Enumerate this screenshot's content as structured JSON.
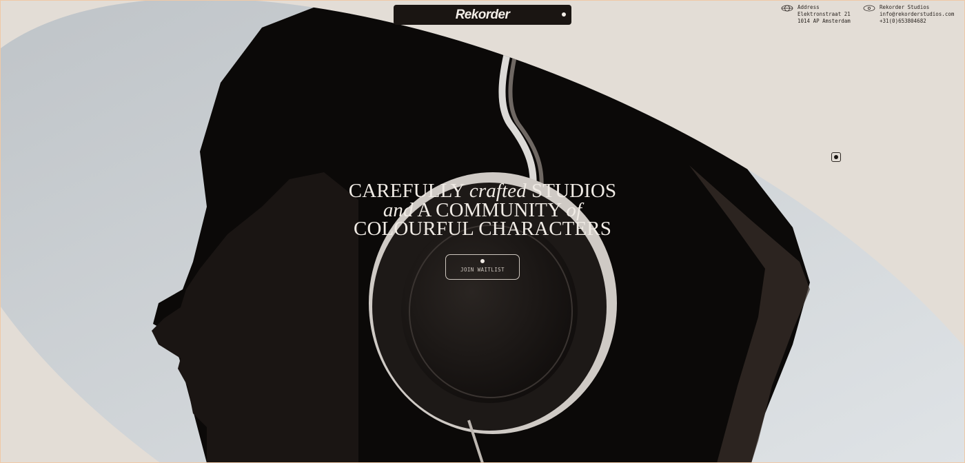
{
  "brand": {
    "name": "Rekorder"
  },
  "contact": {
    "address": {
      "title": "Address",
      "line1": "Elektronstraat 21",
      "line2": "1014 AP Amsterdam"
    },
    "studio": {
      "title": "Rekorder Studios",
      "email": "info@rekorderstudios.com",
      "phone": "+31(0)653804682"
    }
  },
  "hero": {
    "line1_a": "CAREFULLY",
    "line1_b": "crafted",
    "line1_c": "STUDIOS",
    "line2_a": "and",
    "line2_b": "A COMMUNITY",
    "line2_c": "of",
    "line3": "COLOURFUL CHARACTERS",
    "cta_label": "JOIN WAITLIST"
  },
  "colors": {
    "background": "#e3ddd6",
    "dark": "#1a1512",
    "light_text": "#f0ebe5"
  },
  "icons": {
    "address": "globe-icon",
    "studio": "at-sign-icon",
    "menu": "menu-dot-icon"
  }
}
